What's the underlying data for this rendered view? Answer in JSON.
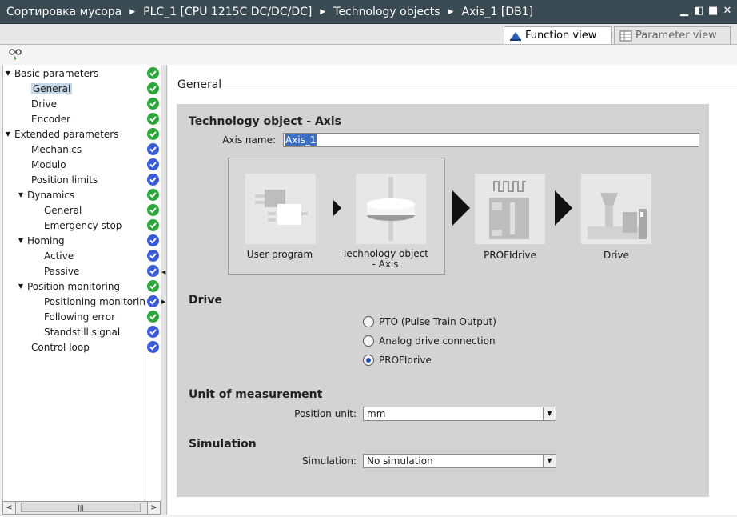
{
  "breadcrumb": [
    "Сортировка мусора",
    "PLC_1 [CPU 1215C DC/DC/DC]",
    "Technology objects",
    "Axis_1 [DB1]"
  ],
  "view_tabs": {
    "function_view": "Function view",
    "parameter_view": "Parameter view"
  },
  "nav": [
    {
      "label": "Basic parameters",
      "status": "green",
      "level": 0,
      "expand": "▼"
    },
    {
      "label": "General",
      "status": "green",
      "level": 1,
      "selected": true
    },
    {
      "label": "Drive",
      "status": "green",
      "level": 1
    },
    {
      "label": "Encoder",
      "status": "green",
      "level": 1
    },
    {
      "label": "Extended parameters",
      "status": "green",
      "level": 0,
      "expand": "▼"
    },
    {
      "label": "Mechanics",
      "status": "blue",
      "level": 1
    },
    {
      "label": "Modulo",
      "status": "blue",
      "level": 1
    },
    {
      "label": "Position limits",
      "status": "blue",
      "level": 1
    },
    {
      "label": "Dynamics",
      "status": "green",
      "level": 1,
      "expand": "▼"
    },
    {
      "label": "General",
      "status": "green",
      "level": 2
    },
    {
      "label": "Emergency stop",
      "status": "green",
      "level": 2
    },
    {
      "label": "Homing",
      "status": "blue",
      "level": 1,
      "expand": "▼"
    },
    {
      "label": "Active",
      "status": "blue",
      "level": 2
    },
    {
      "label": "Passive",
      "status": "blue",
      "level": 2
    },
    {
      "label": "Position monitoring",
      "status": "green",
      "level": 1,
      "expand": "▼"
    },
    {
      "label": "Positioning monitoring",
      "status": "blue",
      "level": 2
    },
    {
      "label": "Following error",
      "status": "green",
      "level": 2
    },
    {
      "label": "Standstill signal",
      "status": "blue",
      "level": 2
    },
    {
      "label": "Control loop",
      "status": "blue",
      "level": 1
    }
  ],
  "main": {
    "section_title": "General",
    "heading": "Technology object - Axis",
    "axis_name_label": "Axis name:",
    "axis_name_value": "Axis_1",
    "diagram": {
      "user_program": "User program",
      "tech_object": "Technology object - Axis",
      "profidrive": "PROFIdrive",
      "drive": "Drive"
    },
    "drive_heading": "Drive",
    "drive_options": [
      {
        "label": "PTO (Pulse Train Output)",
        "checked": false
      },
      {
        "label": "Analog drive connection",
        "checked": false
      },
      {
        "label": "PROFIdrive",
        "checked": true
      }
    ],
    "unit_heading": "Unit of measurement",
    "position_unit_label": "Position unit:",
    "position_unit_value": "mm",
    "sim_heading": "Simulation",
    "sim_label": "Simulation:",
    "sim_value": "No simulation"
  },
  "colors": {
    "status_green": "#2da53a",
    "status_blue": "#3a5ad6",
    "titlebar": "#3a4a52"
  }
}
